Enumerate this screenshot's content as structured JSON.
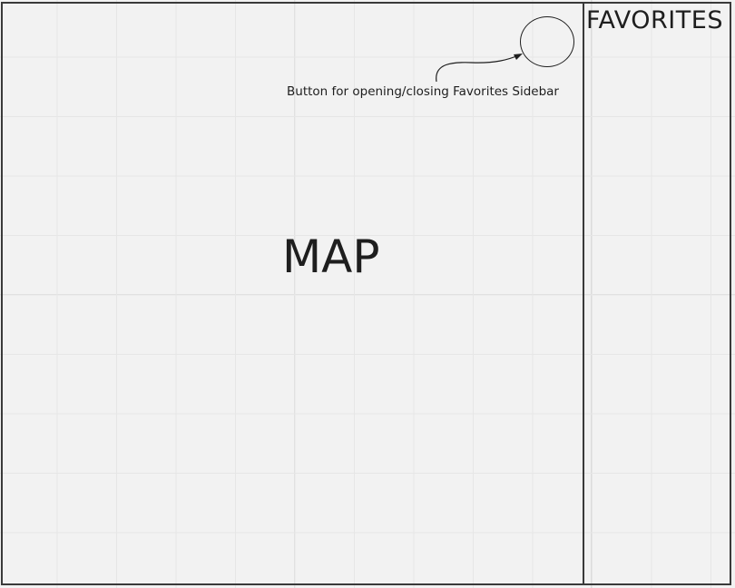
{
  "map": {
    "label": "MAP"
  },
  "sidebar": {
    "title": "FAVORITES"
  },
  "toggle_button": {
    "annotation": "Button for opening/closing Favorites Sidebar"
  }
}
